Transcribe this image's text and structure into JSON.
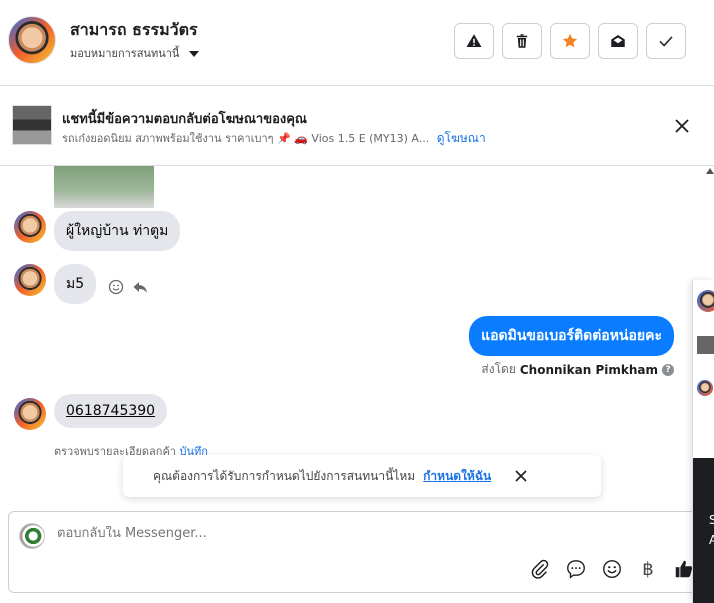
{
  "header": {
    "contact_name": "สามารถ ธรรมวัตร",
    "assign_label": "มอบหมายการสนทนานี้"
  },
  "ad_banner": {
    "title": "แชทนี้มีข้อความตอบกลับต่อโฆษณาของคุณ",
    "subtitle": "รถเก๋งยอดนิยม สภาพพร้อมใช้งาน ราคาเบาๆ 📌 🚗 Vios 1.5 E (MY13) A...",
    "link": "ดูโฆษณา"
  },
  "messages": [
    {
      "from": "contact",
      "text": "ผู้ใหญ่บ้าน ท่าตูม"
    },
    {
      "from": "contact",
      "text": "ม5"
    },
    {
      "from": "page",
      "text": "แอดมินขอเบอร์ติดต่อหน่อยคะ"
    },
    {
      "from": "contact",
      "text": "0618745390"
    }
  ],
  "sent_by": {
    "prefix": "ส่งโดย",
    "name": "Chonnikan Pimkham"
  },
  "check_row": {
    "text": "ตรวจพบรายละเอียดลูกค้า",
    "link": "บันทึก"
  },
  "reminder": {
    "text": "คุณต้องการได้รับการกำหนดไปยังการสนทนานี้ไหม",
    "link": "กำหนดให้ฉัน"
  },
  "composer": {
    "placeholder": "ตอบกลับใน Messenger...",
    "currency_symbol": "฿"
  },
  "side_panel": {
    "text_1": "S",
    "text_2": "A"
  },
  "colors": {
    "accent": "#0a7cff",
    "link": "#1b74e4",
    "star": "#f5821f"
  }
}
